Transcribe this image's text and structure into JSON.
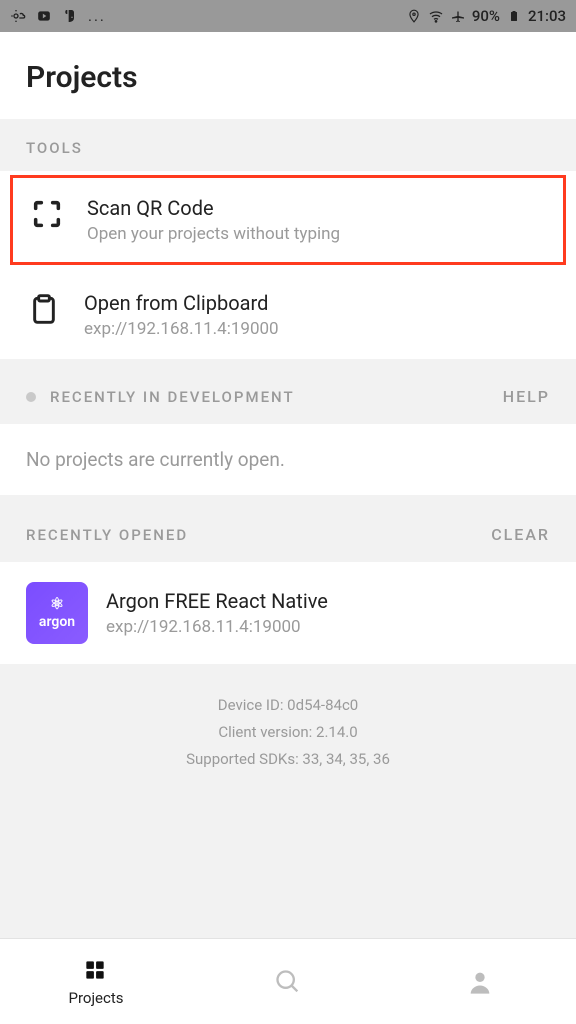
{
  "status": {
    "battery_pct": "90%",
    "time": "21:03"
  },
  "header": {
    "title": "Projects"
  },
  "tools": {
    "label": "TOOLS",
    "scan": {
      "title": "Scan QR Code",
      "sub": "Open your projects without typing"
    },
    "clipboard": {
      "title": "Open from Clipboard",
      "sub": "exp://192.168.11.4:19000"
    }
  },
  "dev": {
    "label": "RECENTLY IN DEVELOPMENT",
    "help": "HELP",
    "empty": "No projects are currently open."
  },
  "recent": {
    "label": "RECENTLY OPENED",
    "clear": "CLEAR",
    "item": {
      "icon_text": "argon",
      "title": "Argon FREE React Native",
      "sub": "exp://192.168.11.4:19000"
    }
  },
  "device": {
    "id": "Device ID: 0d54-84c0",
    "client": "Client version: 2.14.0",
    "sdks": "Supported SDKs: 33, 34, 35, 36"
  },
  "tabs": {
    "projects": "Projects"
  }
}
